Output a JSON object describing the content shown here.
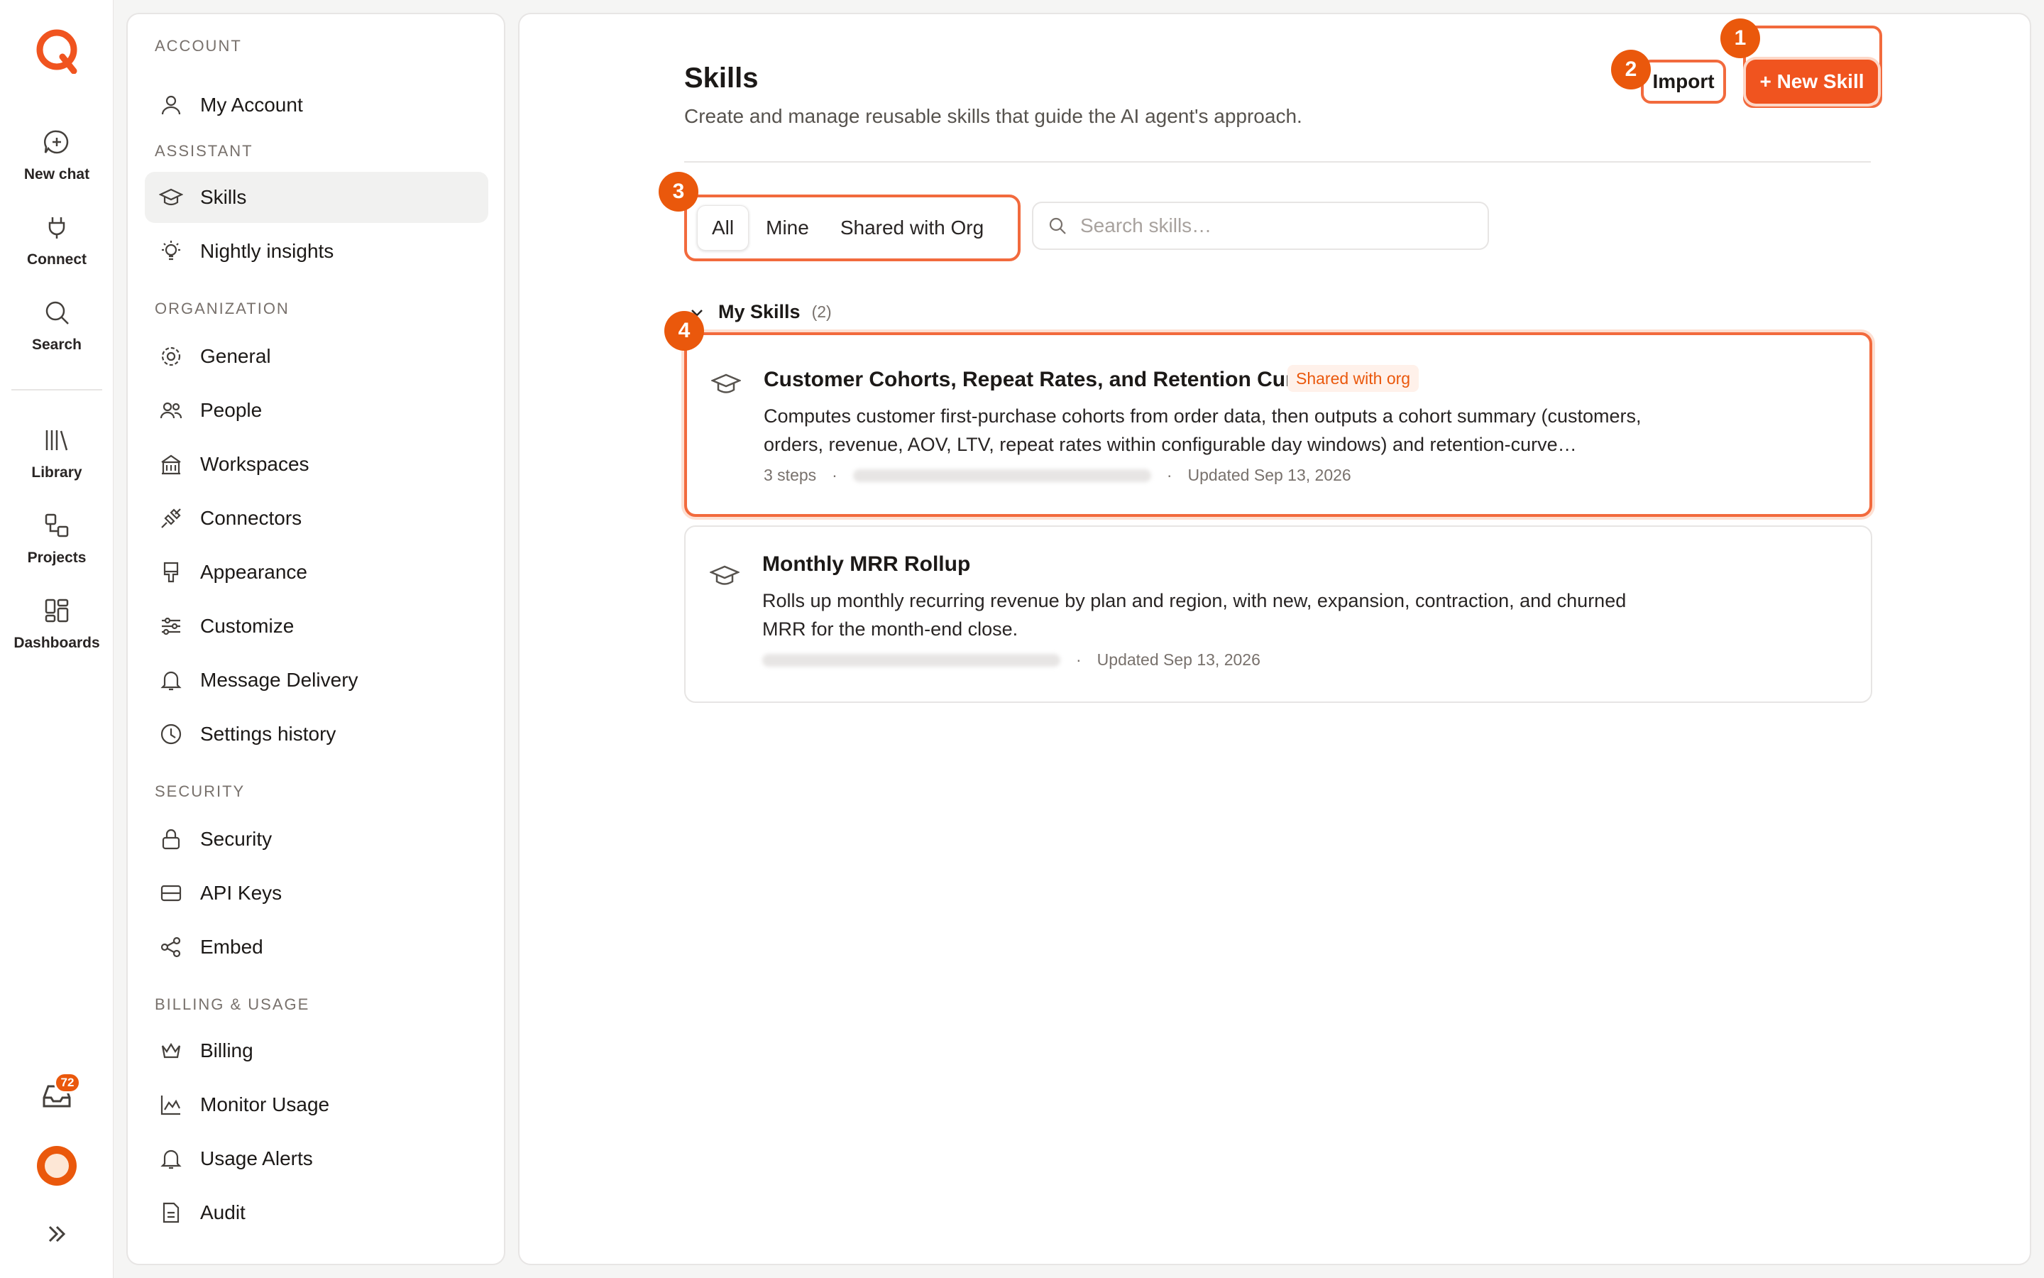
{
  "rail": {
    "items": [
      {
        "label": "New chat",
        "icon": "new-chat-icon"
      },
      {
        "label": "Connect",
        "icon": "plug-icon"
      },
      {
        "label": "Search",
        "icon": "search-icon"
      },
      {
        "label": "Library",
        "icon": "library-icon"
      },
      {
        "label": "Projects",
        "icon": "projects-icon"
      },
      {
        "label": "Dashboards",
        "icon": "dashboards-icon"
      }
    ],
    "inbox_count": "72"
  },
  "nav": {
    "sections": {
      "account": "ACCOUNT",
      "assistant": "ASSISTANT",
      "organization": "ORGANIZATION",
      "security": "SECURITY",
      "billing": "BILLING & USAGE"
    },
    "items": {
      "my_account": "My Account",
      "skills": "Skills",
      "nightly_insights": "Nightly insights",
      "general": "General",
      "people": "People",
      "workspaces": "Workspaces",
      "connectors": "Connectors",
      "appearance": "Appearance",
      "customize": "Customize",
      "message_delivery": "Message Delivery",
      "settings_history": "Settings history",
      "security": "Security",
      "api_keys": "API Keys",
      "embed": "Embed",
      "billing": "Billing",
      "monitor_usage": "Monitor Usage",
      "usage_alerts": "Usage Alerts",
      "audit": "Audit"
    }
  },
  "main": {
    "title": "Skills",
    "subtitle": "Create and manage reusable skills that guide the AI agent's approach.",
    "import_label": "Import",
    "new_skill_label": "+ New Skill",
    "filters": {
      "all": "All",
      "mine": "Mine",
      "shared": "Shared with Org"
    },
    "search_placeholder": "Search skills…",
    "group": {
      "title": "My Skills",
      "count": "(2)"
    },
    "skills": [
      {
        "title": "Customer Cohorts, Repeat Rates, and Retention Curves",
        "badge": "Shared with org",
        "description": "Computes customer first-purchase cohorts from order data, then outputs a cohort summary (customers, orders, revenue, AOV, LTV, repeat rates within configurable day windows) and retention-curve…",
        "steps": "3 steps",
        "updated": "Updated Sep 13, 2026"
      },
      {
        "title": "Monthly MRR Rollup",
        "description": "Rolls up monthly recurring revenue by plan and region, with new, expansion, contraction, and churned MRR for the month-end close.",
        "updated": "Updated Sep 13, 2026"
      }
    ]
  },
  "annotations": {
    "n1": "1",
    "n2": "2",
    "n3": "3",
    "n4": "4"
  },
  "colors": {
    "accent": "#ea580c",
    "highlight": "#f26a3d"
  }
}
